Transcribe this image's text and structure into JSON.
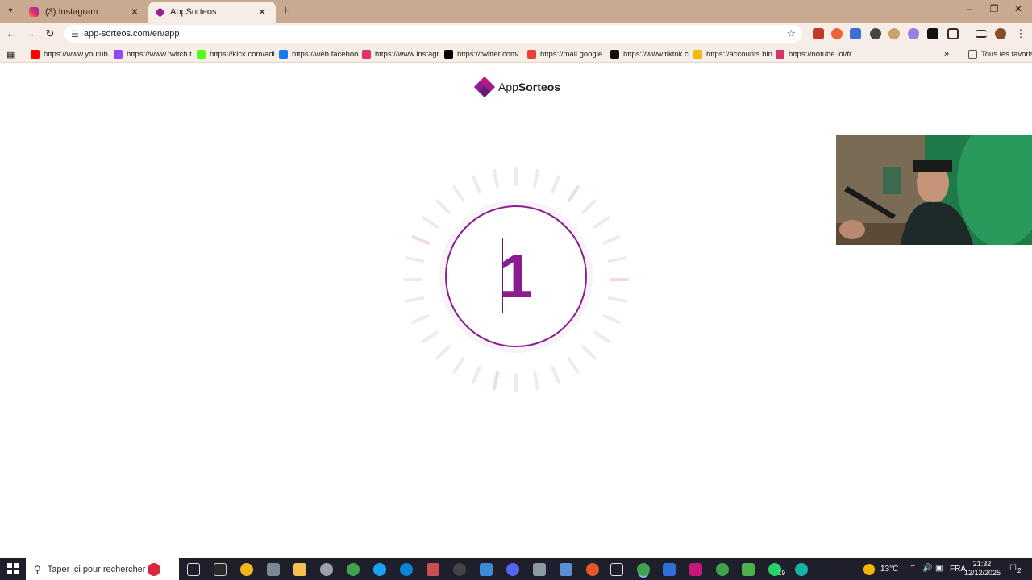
{
  "browser": {
    "tabs": [
      {
        "title": "(3) Instagram",
        "favicon": "instagram-icon",
        "active": false
      },
      {
        "title": "AppSorteos",
        "favicon": "appsorteos-icon",
        "active": true
      }
    ],
    "address": "app-sorteos.com/en/app",
    "bookmarks": [
      {
        "label": "https://www.youtub...",
        "icon": "youtube-icon",
        "color": "#ff0000"
      },
      {
        "label": "https://www.twitch.t...",
        "icon": "twitch-icon",
        "color": "#9146ff"
      },
      {
        "label": "https://kick.com/adi...",
        "icon": "kick-icon",
        "color": "#53fc18"
      },
      {
        "label": "https://web.faceboo...",
        "icon": "facebook-icon",
        "color": "#1877f2"
      },
      {
        "label": "https://www.instagr...",
        "icon": "instagram-icon",
        "color": "#e1306c"
      },
      {
        "label": "https://twitter.com/...",
        "icon": "x-icon",
        "color": "#000000"
      },
      {
        "label": "https://mail.google....",
        "icon": "gmail-icon",
        "color": "#ea4335"
      },
      {
        "label": "https://www.tiktok.c...",
        "icon": "tiktok-icon",
        "color": "#111111"
      },
      {
        "label": "https://accounts.bin...",
        "icon": "binance-icon",
        "color": "#f0b90b"
      },
      {
        "label": "https://notube.lol/fr...",
        "icon": "notube-icon",
        "color": "#d6336c"
      }
    ],
    "all_bookmarks_label": "Tous les favoris"
  },
  "page": {
    "logo": {
      "prefix": "App",
      "suffix": "Sorteos"
    },
    "countdown": "1",
    "accent_color": "#8a1d8f"
  },
  "taskbar": {
    "search_placeholder": "Taper ici pour rechercher",
    "weather": "13°C",
    "language": "FRA",
    "time": "21:32",
    "date": "12/12/2025",
    "notification_count": "2",
    "whatsapp_badge": "19"
  }
}
